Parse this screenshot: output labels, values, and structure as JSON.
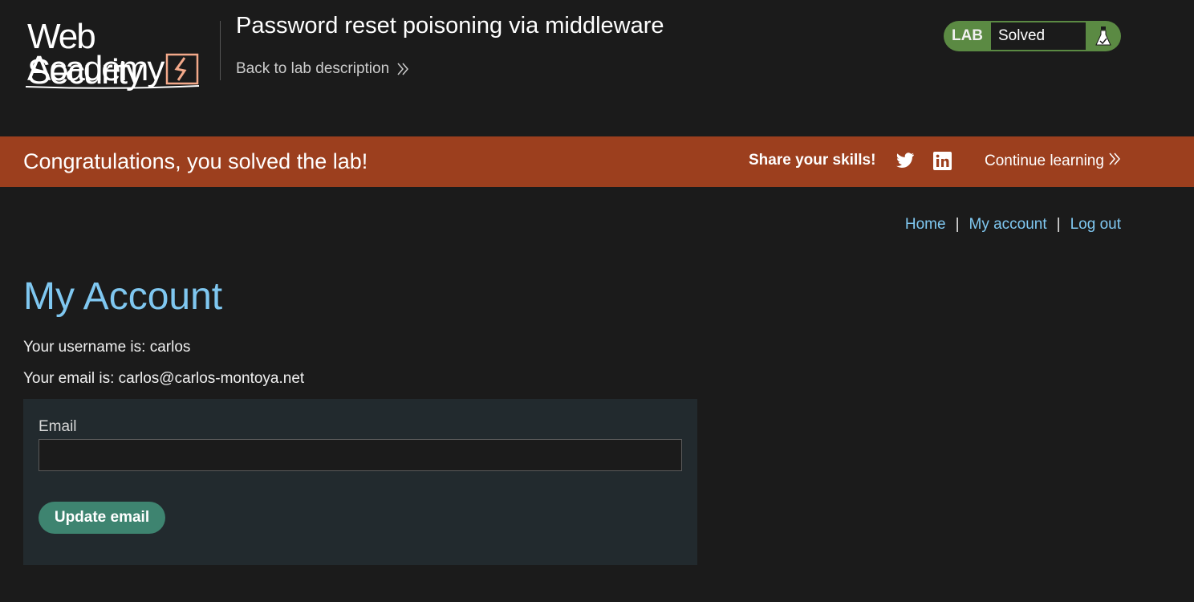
{
  "header": {
    "logo_line1": "Web Security",
    "logo_line2": "Academy",
    "lab_title": "Password reset poisoning via middleware",
    "back_link": "Back to lab description",
    "status_label": "LAB",
    "status_value": "Solved"
  },
  "banner": {
    "message": "Congratulations, you solved the lab!",
    "share": "Share your skills!",
    "continue": "Continue learning"
  },
  "nav": {
    "home": "Home",
    "sep1": "|",
    "my_account": "My account",
    "sep2": "|",
    "logout": "Log out"
  },
  "main": {
    "title": "My Account",
    "username_line": "Your username is: carlos",
    "email_line": "Your email is: carlos@carlos-montoya.net",
    "form": {
      "email_label": "Email",
      "email_value": "",
      "submit": "Update email"
    }
  },
  "colors": {
    "accent_blue": "#7fc7f0",
    "banner_orange": "#9c3f1e",
    "status_green": "#5b8a43",
    "button_teal": "#3e8470"
  }
}
